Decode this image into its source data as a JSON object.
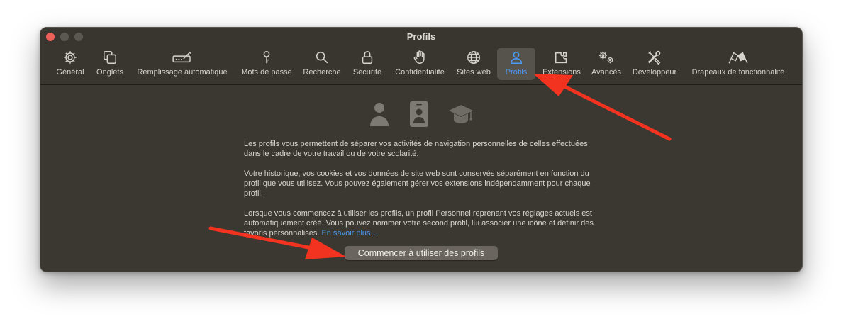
{
  "window": {
    "title": "Profils"
  },
  "tabs": [
    {
      "label": "Général",
      "icon": "gear-icon"
    },
    {
      "label": "Onglets",
      "icon": "tabs-icon"
    },
    {
      "label": "Remplissage automatique",
      "icon": "autofill-pencil-icon"
    },
    {
      "label": "Mots de passe",
      "icon": "key-icon"
    },
    {
      "label": "Recherche",
      "icon": "search-icon"
    },
    {
      "label": "Sécurité",
      "icon": "lock-icon"
    },
    {
      "label": "Confidentialité",
      "icon": "hand-icon"
    },
    {
      "label": "Sites web",
      "icon": "globe-icon"
    },
    {
      "label": "Profils",
      "icon": "person-icon",
      "selected": true
    },
    {
      "label": "Extensions",
      "icon": "puzzle-icon"
    },
    {
      "label": "Avancés",
      "icon": "gears-icon"
    },
    {
      "label": "Développeur",
      "icon": "tools-icon"
    },
    {
      "label": "Drapeaux de fonctionnalité",
      "icon": "flags-icon"
    }
  ],
  "content": {
    "hero_icons": [
      "person-icon",
      "badge-icon",
      "graduation-cap-icon"
    ],
    "para1": "Les profils vous permettent de séparer vos activités de navigation personnelles de celles effectuées dans le cadre de votre travail ou de votre scolarité.",
    "para2": "Votre historique, vos cookies et vos données de site web sont conservés séparément en fonction du profil que vous utilisez. Vous pouvez également gérer vos extensions indépendamment pour chaque profil.",
    "para3": "Lorsque vous commencez à utiliser les profils, un profil Personnel reprenant vos réglages actuels est automatiquement créé. Vous pouvez nommer votre second profil, lui associer une icône et définir des favoris personnalisés.",
    "learn_more": "En savoir plus…",
    "cta_label": "Commencer à utiliser des profils"
  },
  "colors": {
    "accent": "#4a9bf5",
    "window_bg": "#3b3731",
    "annotation_arrow": "#f2331f"
  }
}
